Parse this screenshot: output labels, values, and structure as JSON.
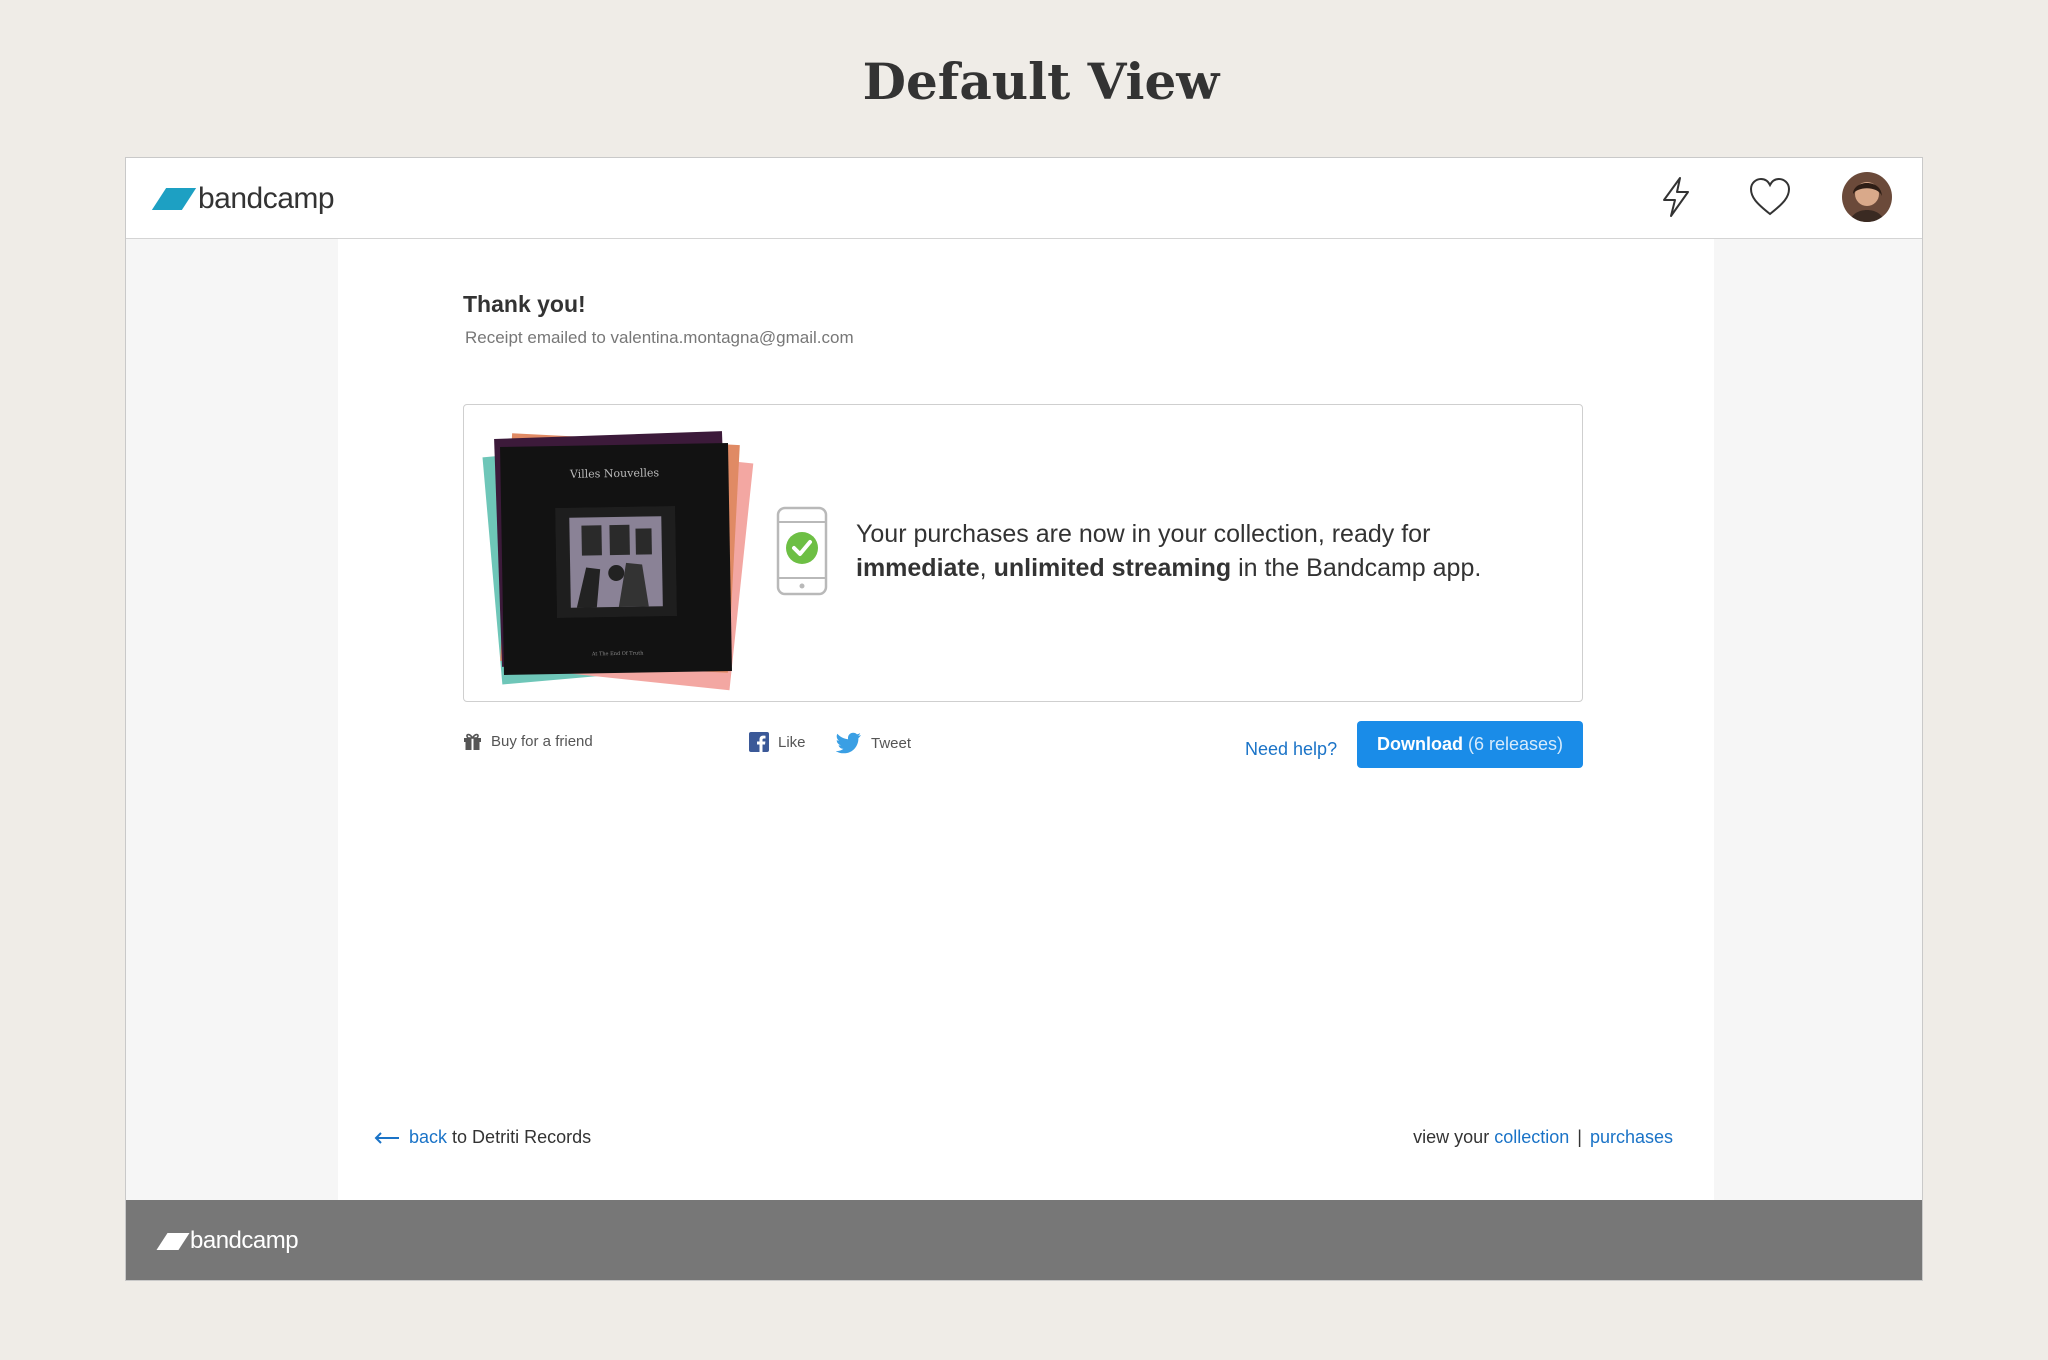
{
  "page": {
    "title": "Default View"
  },
  "header": {
    "logo_text": "bandcamp",
    "icons": [
      "bolt-icon",
      "heart-icon",
      "avatar"
    ]
  },
  "purchase": {
    "heading": "Thank you!",
    "receipt_text": "Receipt emailed to valentina.montagna@gmail.com",
    "cover_title": "Villes Nouvelles",
    "cover_subtitle": "At The End Of Truth",
    "message_part1": "Your purchases are now in your collection, ready for",
    "message_bold1": "immediate",
    "message_comma": ",",
    "message_bold2": "unlimited streaming",
    "message_part2": "in the Bandcamp app."
  },
  "actions": {
    "buy_for_friend": "Buy for a friend",
    "like": "Like",
    "tweet": "Tweet",
    "need_help": "Need help?",
    "download_label": "Download",
    "download_count": "(6 releases)"
  },
  "bottom": {
    "back_link": "back",
    "back_suffix": "to Detriti Records",
    "view_your": "view your",
    "collection": "collection",
    "separator": "|",
    "purchases": "purchases"
  },
  "footer": {
    "logo_text": "bandcamp"
  },
  "colors": {
    "accent": "#1a8ce8",
    "link": "#1a73c7",
    "logo": "#1da0c3",
    "footer_bg": "#777777"
  }
}
